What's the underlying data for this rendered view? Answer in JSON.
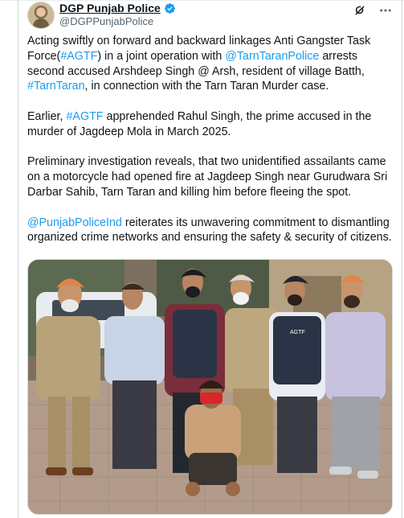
{
  "account": {
    "display_name": "DGP Punjab Police",
    "handle": "@DGPPunjabPolice",
    "verified": true,
    "icons": [
      "verified-badge-icon",
      "grok-icon",
      "more-icon"
    ]
  },
  "tweet": {
    "p1": {
      "t1": "Acting swiftly on forward and backward linkages Anti Gangster Task Force(",
      "l1": "#AGTF",
      "t2": ") in a joint operation with ",
      "l2": "@TarnTaranPolice",
      "t3": " arrests second accused Arshdeep Singh @ Arsh, resident of village Batth, ",
      "l3": "#TarnTaran",
      "t4": ", in connection with the Tarn Taran Murder case."
    },
    "p2": {
      "t1": "Earlier, ",
      "l1": "#AGTF",
      "t2": " apprehended Rahul Singh, the prime accused in the murder of Jagdeep Mola in March 2025."
    },
    "p3": {
      "t1": "Preliminary investigation reveals, that two unidentified assailants came on a motorcycle had opened fire at Jagdeep Singh near Gurudwara Sri Darbar Sahib, Tarn Taran and killing him before fleeing the spot."
    },
    "p4": {
      "l1": "@PunjabPoliceInd",
      "t1": " reiterates its unwavering commitment to dismantling organized crime networks and ensuring the safety & security of citizens."
    }
  },
  "media": {
    "vest_text": "AGTF",
    "colors": {
      "link": "#1d9bf0",
      "verified": "#1d9bf0",
      "khaki": "#b8a27a",
      "navy_vest": "#2b3446",
      "turban_orange": "#e0854a",
      "mask_red": "#d8262b"
    }
  }
}
